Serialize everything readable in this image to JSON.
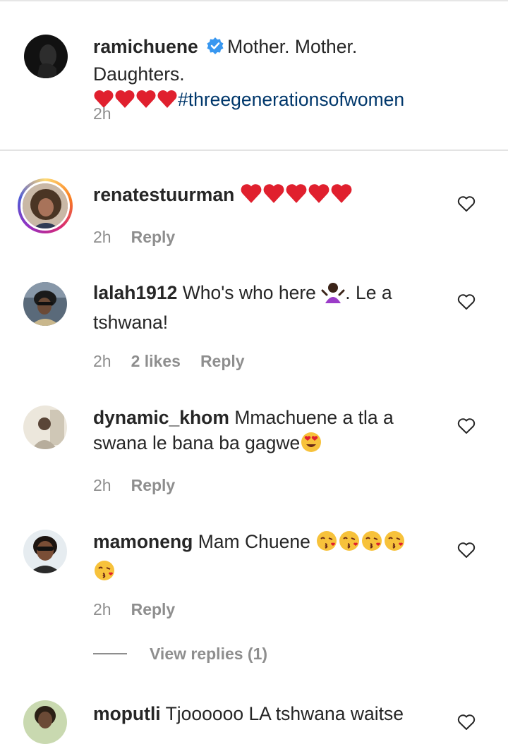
{
  "caption": {
    "username": "ramichuene",
    "text": "Mother. Mother. Daughters.",
    "hashtag": "#threegenerationsofwomen",
    "time": "2h"
  },
  "comments": [
    {
      "username": "renatestuurman",
      "text": "",
      "time": "2h",
      "likes": "",
      "reply_label": "Reply"
    },
    {
      "username": "lalah1912",
      "text": "Who's who here",
      "text2": ". Le a",
      "text3": "tshwana!",
      "time": "2h",
      "likes": "2 likes",
      "reply_label": "Reply"
    },
    {
      "username": "dynamic_khom",
      "text": "Mmachuene a tla a",
      "text2": "swana le bana ba gagwe",
      "time": "2h",
      "likes": "",
      "reply_label": "Reply"
    },
    {
      "username": "mamoneng",
      "text": "Mam Chuene",
      "time": "2h",
      "likes": "",
      "reply_label": "Reply"
    },
    {
      "username": "moputli",
      "text": "Tjoooooo LA tshwana waitse",
      "time": "",
      "likes": "",
      "reply_label": ""
    }
  ],
  "view_replies": "View replies (1)",
  "colors": {
    "heart": "#e0202e",
    "hashtag": "#00376b",
    "meta": "#8e8e8e",
    "verified": "#3897f0"
  }
}
